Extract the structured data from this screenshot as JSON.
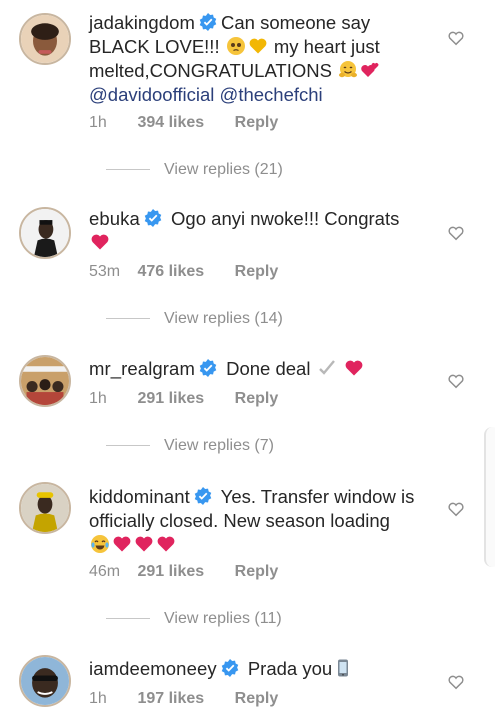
{
  "comments": [
    {
      "username": "jadakingdom",
      "text_parts": [
        "Can someone say BLACK LOVE!!! ",
        " my heart just melted,CONGRATULATIONS ",
        " "
      ],
      "mentions": [
        "@davidoofficial",
        "@thechefchi"
      ],
      "time": "1h",
      "likes": "394 likes",
      "reply": "Reply",
      "view_replies": "View replies (21)"
    },
    {
      "username": "ebuka",
      "text": "Ogo anyi nwoke!!! Congrats",
      "time": "53m",
      "likes": "476 likes",
      "reply": "Reply",
      "view_replies": "View replies (14)"
    },
    {
      "username": "mr_realgram",
      "text": "Done deal",
      "time": "1h",
      "likes": "291 likes",
      "reply": "Reply",
      "view_replies": "View replies (7)"
    },
    {
      "username": "kiddominant",
      "text": "Yes. Transfer window is officially closed. New season loading",
      "time": "46m",
      "likes": "291 likes",
      "reply": "Reply",
      "view_replies": "View replies (11)"
    },
    {
      "username": "iamdeemoneey",
      "text": "Prada you",
      "time": "1h",
      "likes": "197 likes",
      "reply": "Reply"
    }
  ],
  "colors": {
    "text": "#262626",
    "meta": "#8e8e8e",
    "verified": "#3897f0",
    "heart": "#e0245e"
  },
  "icons": {
    "verified": "verified-badge-icon",
    "like": "heart-outline-icon"
  }
}
